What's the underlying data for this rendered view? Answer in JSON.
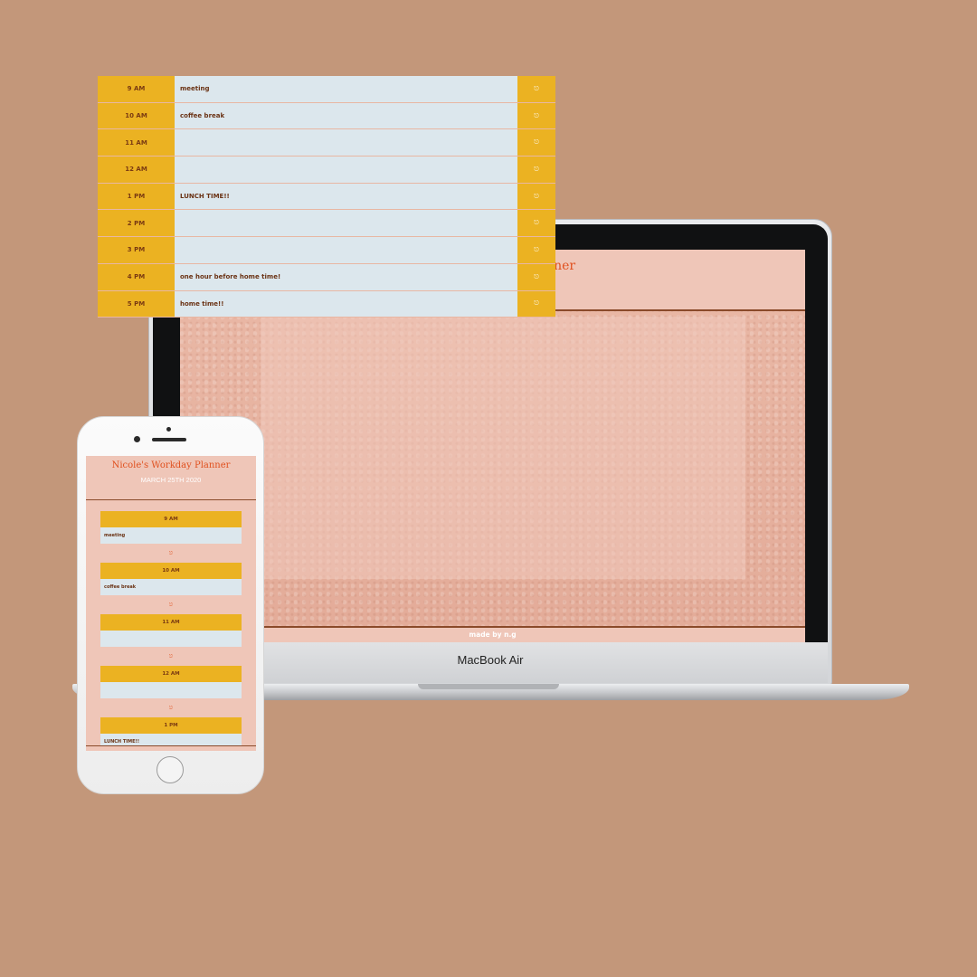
{
  "planner": {
    "title": "Nicole's Workday Planner",
    "date": "MARCH 25TH 2020",
    "save_icon": "save-icon",
    "footer": "made by n.g",
    "rows": [
      {
        "hour": "9 AM",
        "text": "meeting"
      },
      {
        "hour": "10 AM",
        "text": "coffee break"
      },
      {
        "hour": "11 AM",
        "text": ""
      },
      {
        "hour": "12 AM",
        "text": ""
      },
      {
        "hour": "1 PM",
        "text": "LUNCH TIME!!"
      },
      {
        "hour": "2 PM",
        "text": ""
      },
      {
        "hour": "3 PM",
        "text": ""
      },
      {
        "hour": "4 PM",
        "text": "one hour before home time!"
      },
      {
        "hour": "5 PM",
        "text": "home time!!"
      }
    ]
  },
  "device": {
    "laptop_brand": "MacBook Air"
  },
  "colors": {
    "background": "#c3977a",
    "accent_yellow": "#ebb222",
    "title_orange": "#e0501e",
    "row_blue": "#dce7ed",
    "header_pink": "#efc6b8"
  }
}
